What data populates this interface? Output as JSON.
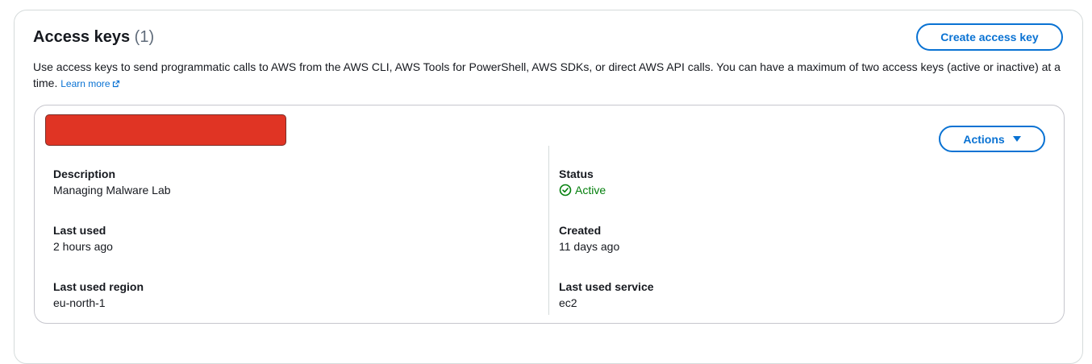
{
  "header": {
    "title": "Access keys",
    "count": "(1)",
    "create_button_label": "Create access key",
    "description": "Use access keys to send programmatic calls to AWS from the AWS CLI, AWS Tools for PowerShell, AWS SDKs, or direct AWS API calls. You can have a maximum of two access keys (active or inactive) at a time.",
    "learn_more_label": "Learn more"
  },
  "key": {
    "actions_label": "Actions",
    "left_fields": [
      {
        "label": "Description",
        "value": "Managing Malware Lab"
      },
      {
        "label": "Last used",
        "value": "2 hours ago"
      },
      {
        "label": "Last used region",
        "value": "eu-north-1"
      }
    ],
    "right_fields": [
      {
        "label": "Status",
        "value": "Active"
      },
      {
        "label": "Created",
        "value": "11 days ago"
      },
      {
        "label": "Last used service",
        "value": "ec2"
      }
    ]
  },
  "icons": {
    "external_link": "external-link-icon",
    "status": "check-circle-icon",
    "actions_caret": "caret-down-icon"
  },
  "colors": {
    "accent": "#0972d3",
    "status_active": "#037f0c",
    "redaction": "#e03424"
  }
}
